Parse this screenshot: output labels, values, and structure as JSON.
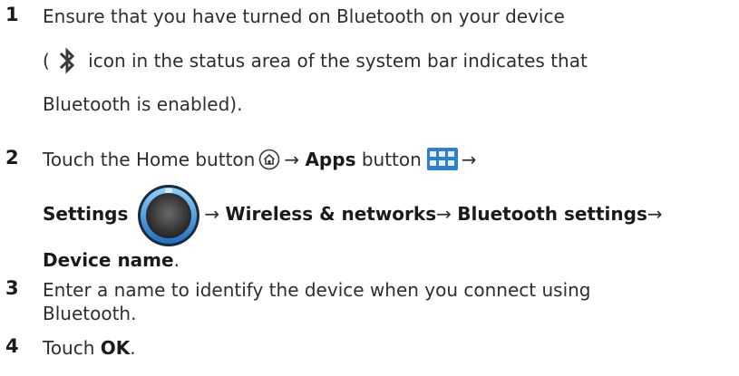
{
  "steps": [
    {
      "number": "1",
      "line1": "Ensure that you have turned on Bluetooth on your device",
      "line2_open": "(",
      "line2_rest": "icon in the status area of the system bar indicates that",
      "line3": "Bluetooth is enabled)."
    },
    {
      "number": "2",
      "touch_text": "Touch the Home button",
      "arrow": "→",
      "apps_label": "Apps",
      "button_word": "button",
      "settings_label": "Settings",
      "wireless_label": "Wireless & networks",
      "bt_settings_label": "Bluetooth settings",
      "device_name_label": "Device name",
      "period": "."
    },
    {
      "number": "3",
      "line1": "Enter a name to identify the device when you connect using",
      "line2": "Bluetooth."
    },
    {
      "number": "4",
      "touch_word": "Touch",
      "ok_label": "OK",
      "period": "."
    }
  ],
  "icons": {
    "bluetooth": "bluetooth-icon",
    "home": "home-icon",
    "apps": "apps-icon",
    "settings": "settings-icon"
  },
  "colors": {
    "text": "#2e2e2e",
    "bold": "#1a1a1a",
    "settings_blue": "#2a8fe0",
    "apps_blue": "#2d7fd6"
  }
}
